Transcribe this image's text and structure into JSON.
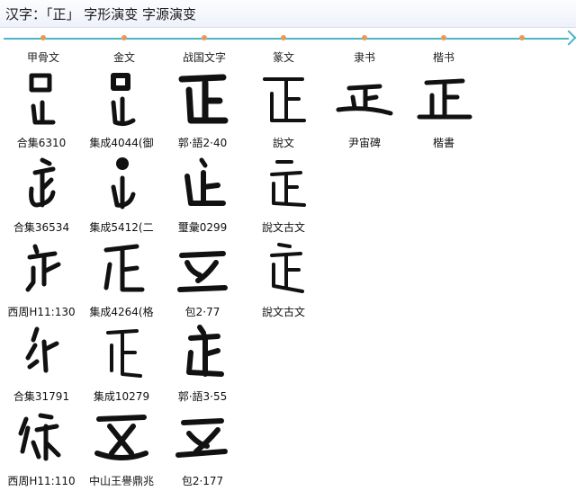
{
  "title": "汉字：「正」 字形演变 字源演变",
  "columns": [
    "甲骨文",
    "金文",
    "战国文字",
    "篆文",
    "隶书",
    "楷书"
  ],
  "rows": [
    [
      "合集6310",
      "集成4044(御",
      "郭·語2·40",
      "說文",
      "尹宙碑",
      "楷書"
    ],
    [
      "合集36534",
      "集成5412(二",
      "璽彙0299",
      "說文古文"
    ],
    [
      "西周H11:130",
      "集成4264(格",
      "包2·77",
      "說文古文"
    ],
    [
      "合集31791",
      "集成10279",
      "郭·語3·55"
    ],
    [
      "西周H11:110",
      "中山王譽鼎兆",
      "包2·177"
    ]
  ]
}
